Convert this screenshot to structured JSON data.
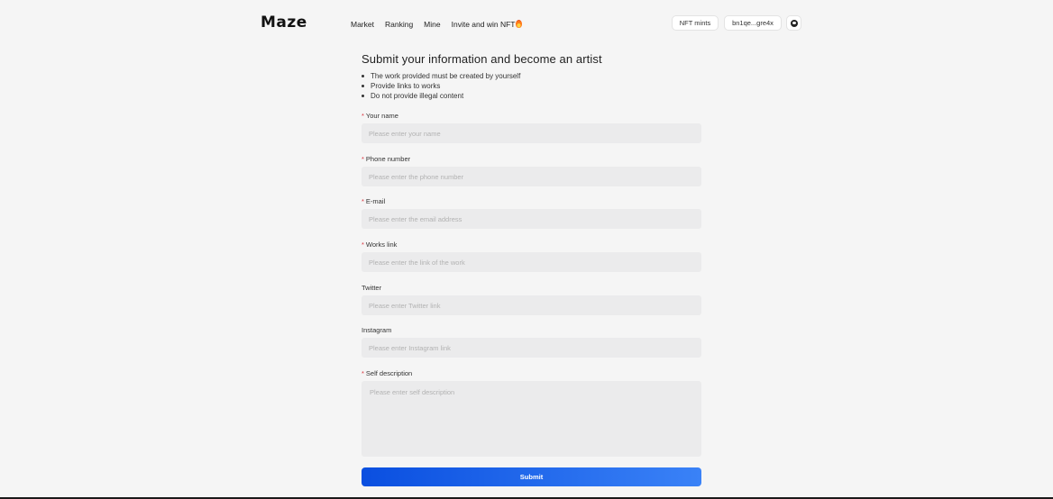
{
  "header": {
    "logo": "Maze",
    "nav": [
      "Market",
      "Ranking",
      "Mine",
      "Invite and win NFT"
    ],
    "nft_mints_label": "NFT mints",
    "wallet_label": "bn1qe...gre4x"
  },
  "form": {
    "title": "Submit your information and become an artist",
    "rules": [
      "The work provided must be created by yourself",
      "Provide links to works",
      "Do not provide illegal content"
    ],
    "fields": [
      {
        "label": "Your name",
        "required": true,
        "placeholder": "Please enter your name"
      },
      {
        "label": "Phone number",
        "required": true,
        "placeholder": "Please enter the phone number"
      },
      {
        "label": "E-mail",
        "required": true,
        "placeholder": "Please enter the email address"
      },
      {
        "label": "Works link",
        "required": true,
        "placeholder": "Please enter the link of the work"
      },
      {
        "label": "Twitter",
        "required": false,
        "placeholder": "Please enter Twitter link"
      },
      {
        "label": "Instagram",
        "required": false,
        "placeholder": "Please enter Instagram link"
      }
    ],
    "description": {
      "label": "Self description",
      "required": true,
      "placeholder": "Please enter self description"
    },
    "submit_label": "Submit"
  },
  "colors": {
    "background": "#f5f5f5",
    "input_bg": "#ebebec",
    "required_mark": "#d9363e",
    "submit_start": "#0a4fe0",
    "submit_end": "#3a82f7"
  },
  "icons": [
    "fire-icon",
    "avatar-icon"
  ]
}
